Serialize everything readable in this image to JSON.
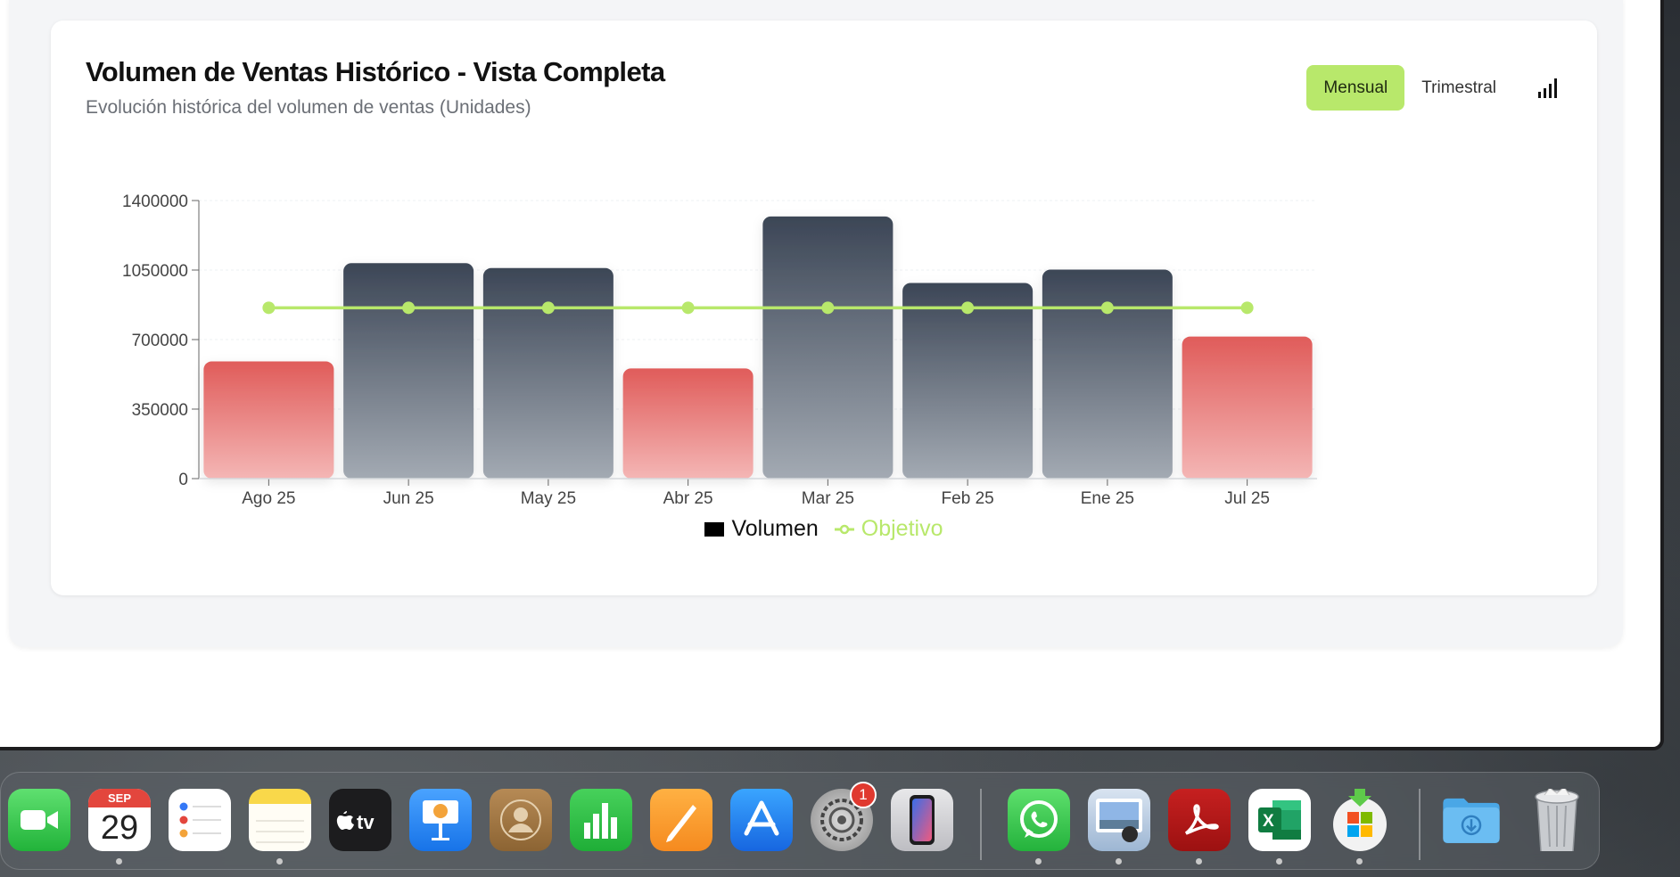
{
  "chart_card": {
    "title": "Volumen de Ventas Histórico - Vista Completa",
    "subtitle": "Evolución histórica del volumen de ventas (Unidades)",
    "buttons": {
      "monthly": "Mensual",
      "quarterly": "Trimestral"
    }
  },
  "legend": {
    "volume": "Volumen",
    "target": "Objetivo"
  },
  "chart_data": {
    "type": "bar",
    "categories": [
      "Ago 25",
      "Jun 25",
      "May 25",
      "Abr 25",
      "Mar 25",
      "Feb 25",
      "Ene 25",
      "Jul 25"
    ],
    "series": [
      {
        "name": "Volumen",
        "values": [
          590000,
          1085000,
          1060000,
          555000,
          1320000,
          985000,
          1052000,
          715000
        ],
        "highlight": [
          true,
          false,
          false,
          true,
          false,
          false,
          false,
          true
        ]
      },
      {
        "name": "Objetivo",
        "type": "line",
        "values": [
          860000,
          860000,
          860000,
          860000,
          860000,
          860000,
          860000,
          860000
        ]
      }
    ],
    "yticks": [
      "1400000",
      "1050000",
      "700000",
      "350000",
      "0"
    ],
    "ytick_values": [
      1400000,
      1050000,
      700000,
      350000,
      0
    ],
    "ylim": [
      0,
      1400000
    ],
    "colors": {
      "dark": "#3c4656",
      "dark_light": "#a3aab3",
      "red": "#e05c5a",
      "red_light": "#f4b6b5",
      "target": "#b8e86b"
    }
  },
  "dock": {
    "calendar_month": "SEP",
    "calendar_day": "29",
    "settings_badge": "1",
    "apps": [
      "FaceTime",
      "Calendar",
      "Reminders",
      "Notes",
      "Apple TV",
      "Keynote",
      "Contacts",
      "Numbers",
      "Pages",
      "App Store",
      "System Settings",
      "iPhone Mirroring",
      "WhatsApp",
      "Preview",
      "Acrobat",
      "Excel",
      "Microsoft AutoUpdate",
      "Downloads",
      "Trash"
    ]
  }
}
